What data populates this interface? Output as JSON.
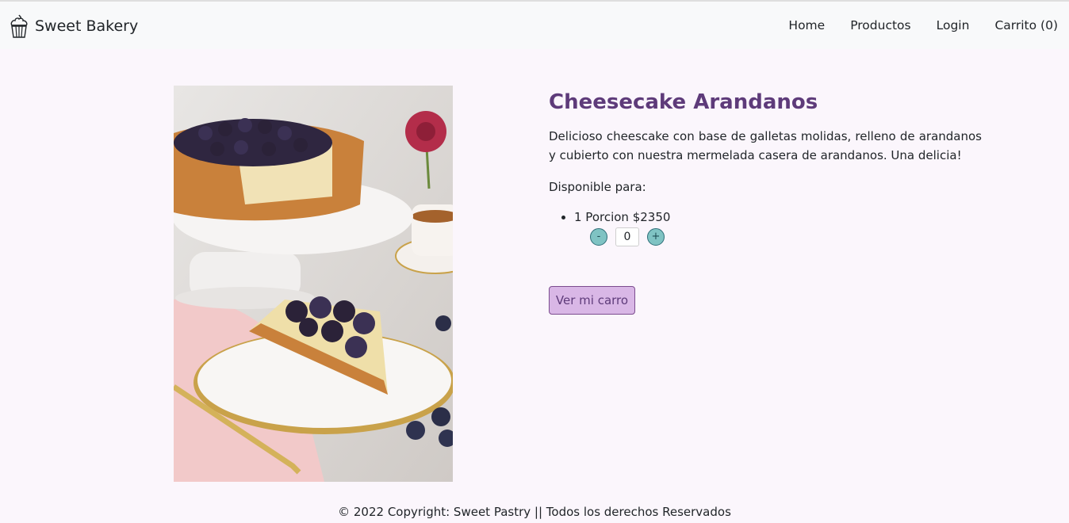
{
  "brand": {
    "name": "Sweet Bakery",
    "icon": "cupcake-icon"
  },
  "nav": {
    "items": [
      {
        "label": "Home"
      },
      {
        "label": "Productos"
      },
      {
        "label": "Login"
      },
      {
        "label": "Carrito (0)"
      }
    ]
  },
  "product": {
    "title": "Cheesecake Arandanos",
    "description": "Delicioso cheescake con base de galletas molidas, relleno de arandanos y cubierto con nuestra mermelada casera de arandanos. Una delicia!",
    "availability_label": "Disponible para:",
    "options": [
      {
        "label": "1 Porcion $2350",
        "quantity": "0",
        "decrement": "-",
        "increment": "+"
      }
    ],
    "cart_button": "Ver mi carro"
  },
  "footer": {
    "text": "© 2022 Copyright: Sweet Pastry || Todos los derechos Reservados"
  },
  "colors": {
    "accent": "#5e3b7a",
    "button_bg": "#d9b7e6",
    "qty_btn": "#7fc3c3",
    "page_bg": "#fbf6fc"
  }
}
